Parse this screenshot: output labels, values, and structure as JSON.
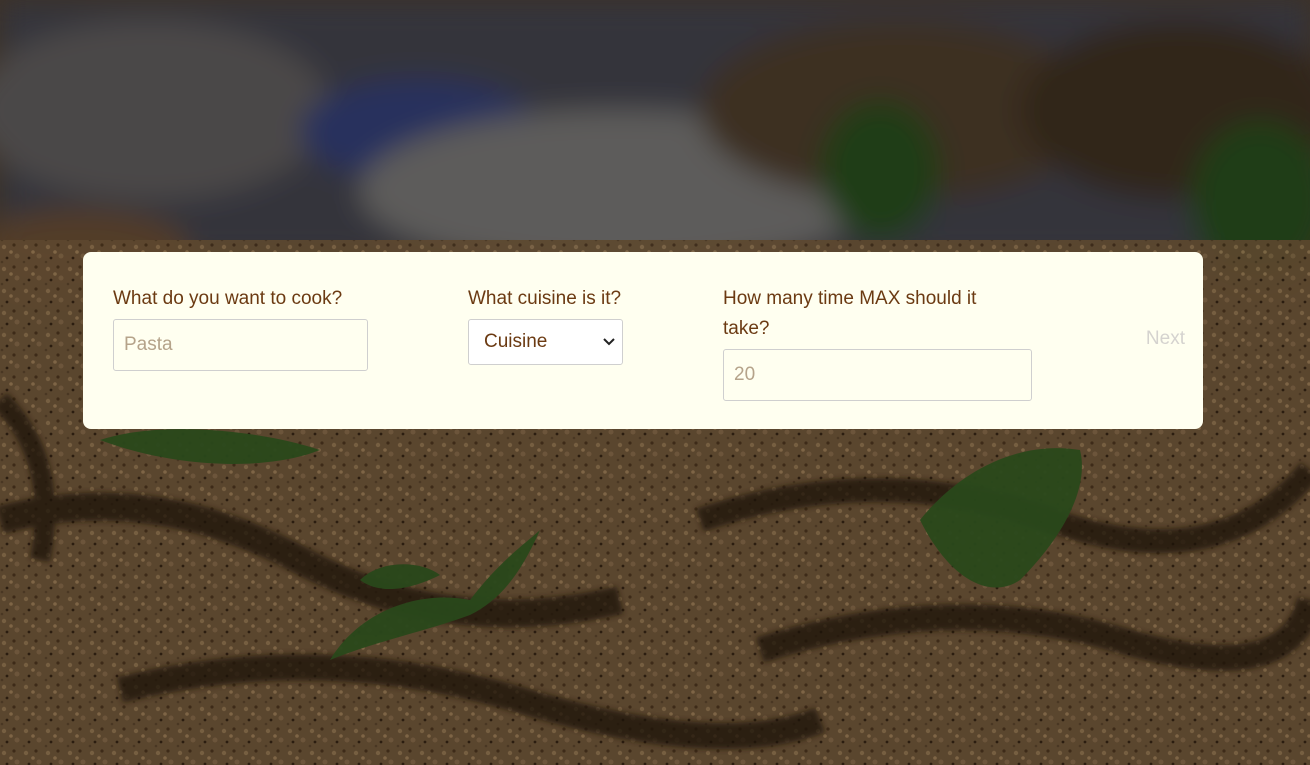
{
  "form": {
    "cook": {
      "label": "What do you want to cook?",
      "placeholder": "Pasta",
      "value": ""
    },
    "cuisine": {
      "label": "What cuisine is it?",
      "selected": "Cuisine"
    },
    "time": {
      "label": "How many time MAX should it take?",
      "placeholder": "20",
      "value": ""
    },
    "next_label": "Next"
  },
  "icons": {
    "cuisine_dropdown": "chevron-down-icon"
  },
  "colors": {
    "card_background": "#fffff0",
    "label_text": "#6b3a12",
    "next_disabled": "#d5d3cf"
  }
}
